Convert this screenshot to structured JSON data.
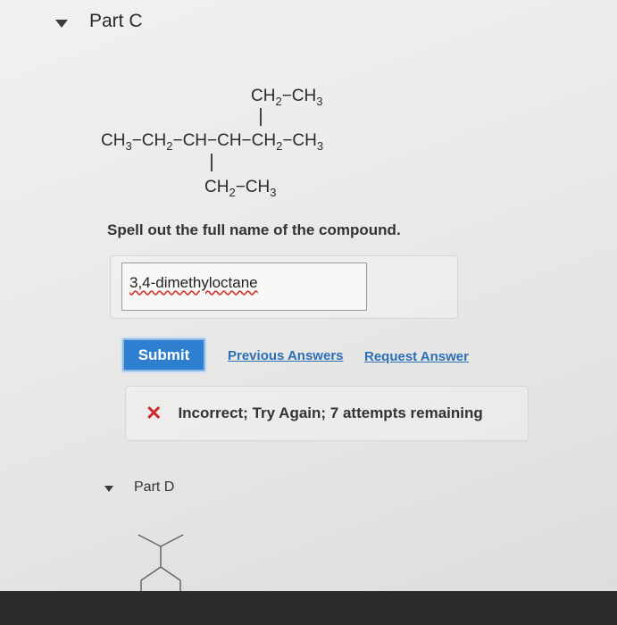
{
  "part_c": {
    "title": "Part C",
    "prompt": "Spell out the full name of the compound.",
    "answer_value": "3,4-dimethyloctane",
    "submit_label": "Submit",
    "previous_answers_label": "Previous Answers",
    "request_answer_label": "Request Answer",
    "feedback_icon": "✕",
    "feedback_text": "Incorrect; Try Again; 7 attempts remaining"
  },
  "structure": {
    "top_branch": [
      "CH",
      "2",
      "−CH",
      "3"
    ],
    "main_chain": [
      "CH",
      "3",
      "−CH",
      "2",
      "−CH−CH−CH",
      "2",
      "−CH",
      "3"
    ],
    "bottom_branch": [
      "CH",
      "2",
      "−CH",
      "3"
    ]
  },
  "part_d": {
    "title": "Part D"
  }
}
